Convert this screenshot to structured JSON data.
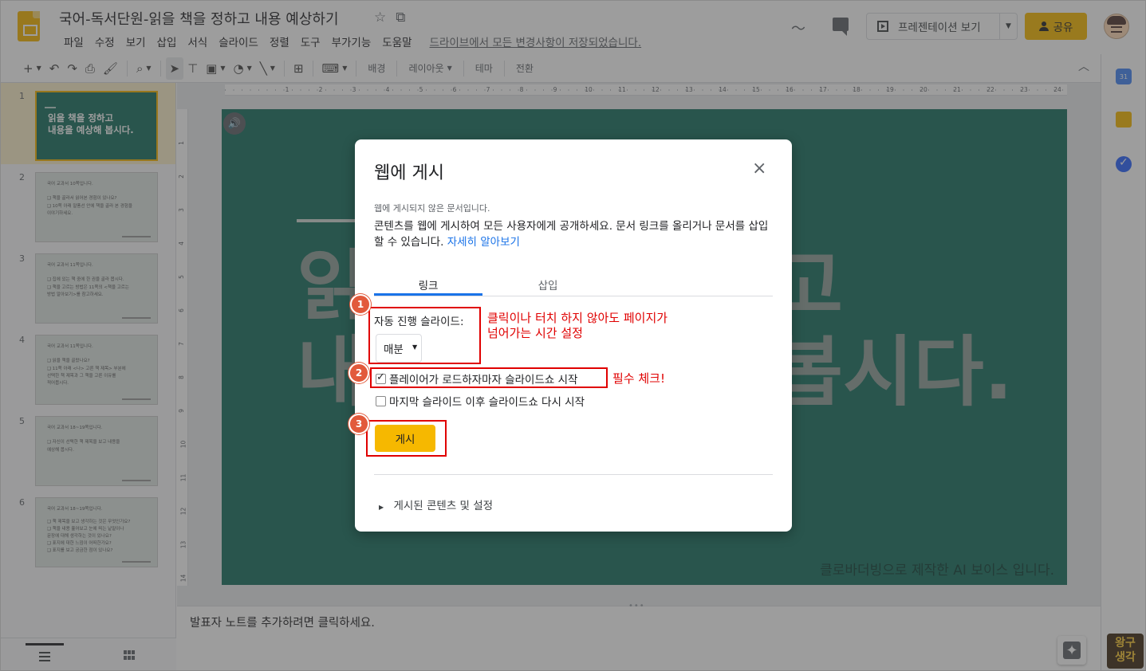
{
  "app": {
    "title": "국어-독서단원-읽을 책을 정하고 내용 예상하기",
    "save_status": "드라이브에서 모든 변경사항이 저장되었습니다."
  },
  "menu": [
    "파일",
    "수정",
    "보기",
    "삽입",
    "서식",
    "슬라이드",
    "정렬",
    "도구",
    "부가기능",
    "도움말"
  ],
  "header_buttons": {
    "present_label": "프레젠테이션 보기",
    "share_label": "공유"
  },
  "toolbar": {
    "add": "+",
    "background_label": "배경",
    "layout_label": "레이아웃",
    "theme_label": "테마",
    "transition_label": "전환"
  },
  "ruler": {
    "top": [
      "1",
      "2",
      "3",
      "4",
      "5",
      "6",
      "7",
      "8",
      "9",
      "10",
      "11",
      "12",
      "13",
      "14",
      "15",
      "16",
      "17",
      "18",
      "19",
      "20",
      "21",
      "22",
      "23",
      "24",
      "25"
    ],
    "left": [
      "1",
      "2",
      "3",
      "4",
      "5",
      "6",
      "7",
      "8",
      "9",
      "10",
      "11",
      "12",
      "13",
      "14"
    ]
  },
  "filmstrip": [
    {
      "num": "1",
      "title_lines": [
        "읽을 책을 정하고",
        "내용을 예상해 봅시다."
      ]
    },
    {
      "num": "2",
      "text_lines": [
        "국어 교과서 10쪽입니다.",
        "❑ 책을 골라서 읽어본 경험이 있나요?",
        "❑ 10쪽 아래 말풍선 안에 책을 골라 본 경험을",
        "   이야기하세요."
      ]
    },
    {
      "num": "3",
      "text_lines": [
        "국어 교과서 11쪽입니다.",
        "❑ 집에 있는 책 중에 한 권을 골라 봅시다.",
        "❑ 책을 고르는 방법은 11쪽의 <책을 고르는",
        "   방법 알아보기>를 참고하세요."
      ]
    },
    {
      "num": "4",
      "text_lines": [
        "국어 교과서 11쪽입니다.",
        "❑ 읽을 책을 골랐나요?",
        "❑ 11쪽 아래 <나> 고른 책 제목> 부분에",
        "   선택한 책 제목과 그 책을 고른 이유를",
        "   적어봅시다."
      ]
    },
    {
      "num": "5",
      "text_lines": [
        "국어 교과서 18~19쪽입니다.",
        "❑ 자신이 선택한 책 제목을 보고 내용을",
        "   예상해 봅시다."
      ]
    },
    {
      "num": "6",
      "text_lines": [
        "국어 교과서 18~19쪽입니다.",
        "❑ 책 제목을 보고 생각하는 것은 무엇인가요?",
        "❑ 책을 내용 훑어보고 눈에 띄는 낱말이나",
        "   문장에 대해 생각하는 것이 있나요?",
        "❑ 표지에 대한 느낌이 어떠한가요?",
        "❑ 표지를 보고 궁금한 점이 있나요?"
      ]
    }
  ],
  "slide": {
    "title_lines": [
      "읽을 책을 정하고",
      "내용을 예상해 봅시다."
    ],
    "footer": "클로바더빙으로 제작한 AI 보이스 입니다."
  },
  "notes": {
    "placeholder": "발표자 노트를 추가하려면 클릭하세요."
  },
  "side_panel": {
    "calendar_day": "31"
  },
  "corner_logo": [
    "왕구",
    "생각"
  ],
  "dialog": {
    "title": "웹에 게시",
    "close": "×",
    "status": "웹에 게시되지 않은 문서입니다.",
    "description": "콘텐츠를 웹에 게시하여 모든 사용자에게 공개하세요. 문서 링크를 올리거나 문서를 삽입할 수 있습니다.",
    "learn_more": "자세히 알아보기",
    "tabs": [
      "링크",
      "삽입"
    ],
    "auto_advance_label": "자동 진행 슬라이드:",
    "auto_advance_value": "매분",
    "start_on_load_label": "플레이어가 로드하자마자 슬라이드쇼 시작",
    "start_on_load_checked": true,
    "restart_label": "마지막 슬라이드 이후 슬라이드쇼 다시 시작",
    "restart_checked": false,
    "publish_label": "게시",
    "published_content_label": "게시된 콘텐츠 및 설정"
  },
  "annotations": {
    "badges": [
      "1",
      "2",
      "3"
    ],
    "note1_lines": [
      "클릭이나 터치 하지 않아도 페이지가",
      "넘어가는 시간 설정"
    ],
    "note2": "필수 체크!"
  },
  "colors": {
    "accent": "#f6b800",
    "slide_bg": "#176e5f",
    "link": "#1a73e8",
    "annotation": "#e00000"
  }
}
